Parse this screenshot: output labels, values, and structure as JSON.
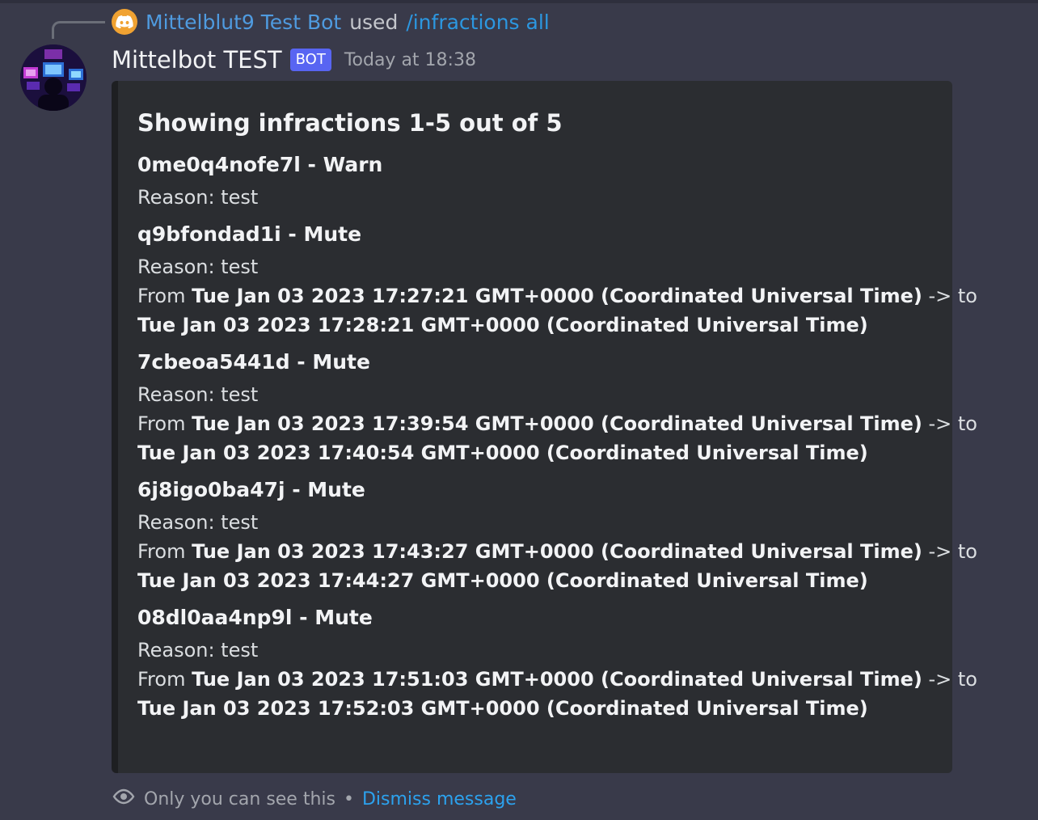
{
  "reply": {
    "user": "Mittelblut9 Test Bot",
    "used": "used",
    "command": "/infractions all",
    "avatar_icon": "discord-logo-icon"
  },
  "message": {
    "author": "Mittelbot TEST",
    "bot_tag": "BOT",
    "timestamp": "Today at 18:38"
  },
  "embed": {
    "title": "Showing infractions 1-5 out of 5",
    "fields": [
      {
        "name": "0me0q4nofe7l - Warn",
        "reason": "Reason: test",
        "from_label": "",
        "from": "",
        "arrow": "",
        "to": ""
      },
      {
        "name": "q9bfondad1i - Mute",
        "reason": "Reason: test",
        "from_label": "From",
        "from": "Tue Jan 03 2023 17:27:21 GMT+0000 (Coordinated Universal Time)",
        "arrow": "-> to",
        "to": "Tue Jan 03 2023 17:28:21 GMT+0000 (Coordinated Universal Time)"
      },
      {
        "name": "7cbeoa5441d - Mute",
        "reason": "Reason: test",
        "from_label": "From",
        "from": "Tue Jan 03 2023 17:39:54 GMT+0000 (Coordinated Universal Time)",
        "arrow": "-> to",
        "to": "Tue Jan 03 2023 17:40:54 GMT+0000 (Coordinated Universal Time)"
      },
      {
        "name": "6j8igo0ba47j - Mute",
        "reason": "Reason: test",
        "from_label": "From",
        "from": "Tue Jan 03 2023 17:43:27 GMT+0000 (Coordinated Universal Time)",
        "arrow": "-> to",
        "to": "Tue Jan 03 2023 17:44:27 GMT+0000 (Coordinated Universal Time)"
      },
      {
        "name": "08dl0aa4np9l - Mute",
        "reason": "Reason: test",
        "from_label": "From",
        "from": "Tue Jan 03 2023 17:51:03 GMT+0000 (Coordinated Universal Time)",
        "arrow": "-> to",
        "to": "Tue Jan 03 2023 17:52:03 GMT+0000 (Coordinated Universal Time)"
      }
    ]
  },
  "footer": {
    "note": "Only you can see this",
    "separator": "•",
    "dismiss": "Dismiss message",
    "icon": "eye-icon"
  },
  "colors": {
    "background": "#393a4a",
    "embed_background": "#2b2d31",
    "link": "#2ca2ee",
    "bot_tag": "#5865f2",
    "reply_avatar": "#f0a232"
  }
}
